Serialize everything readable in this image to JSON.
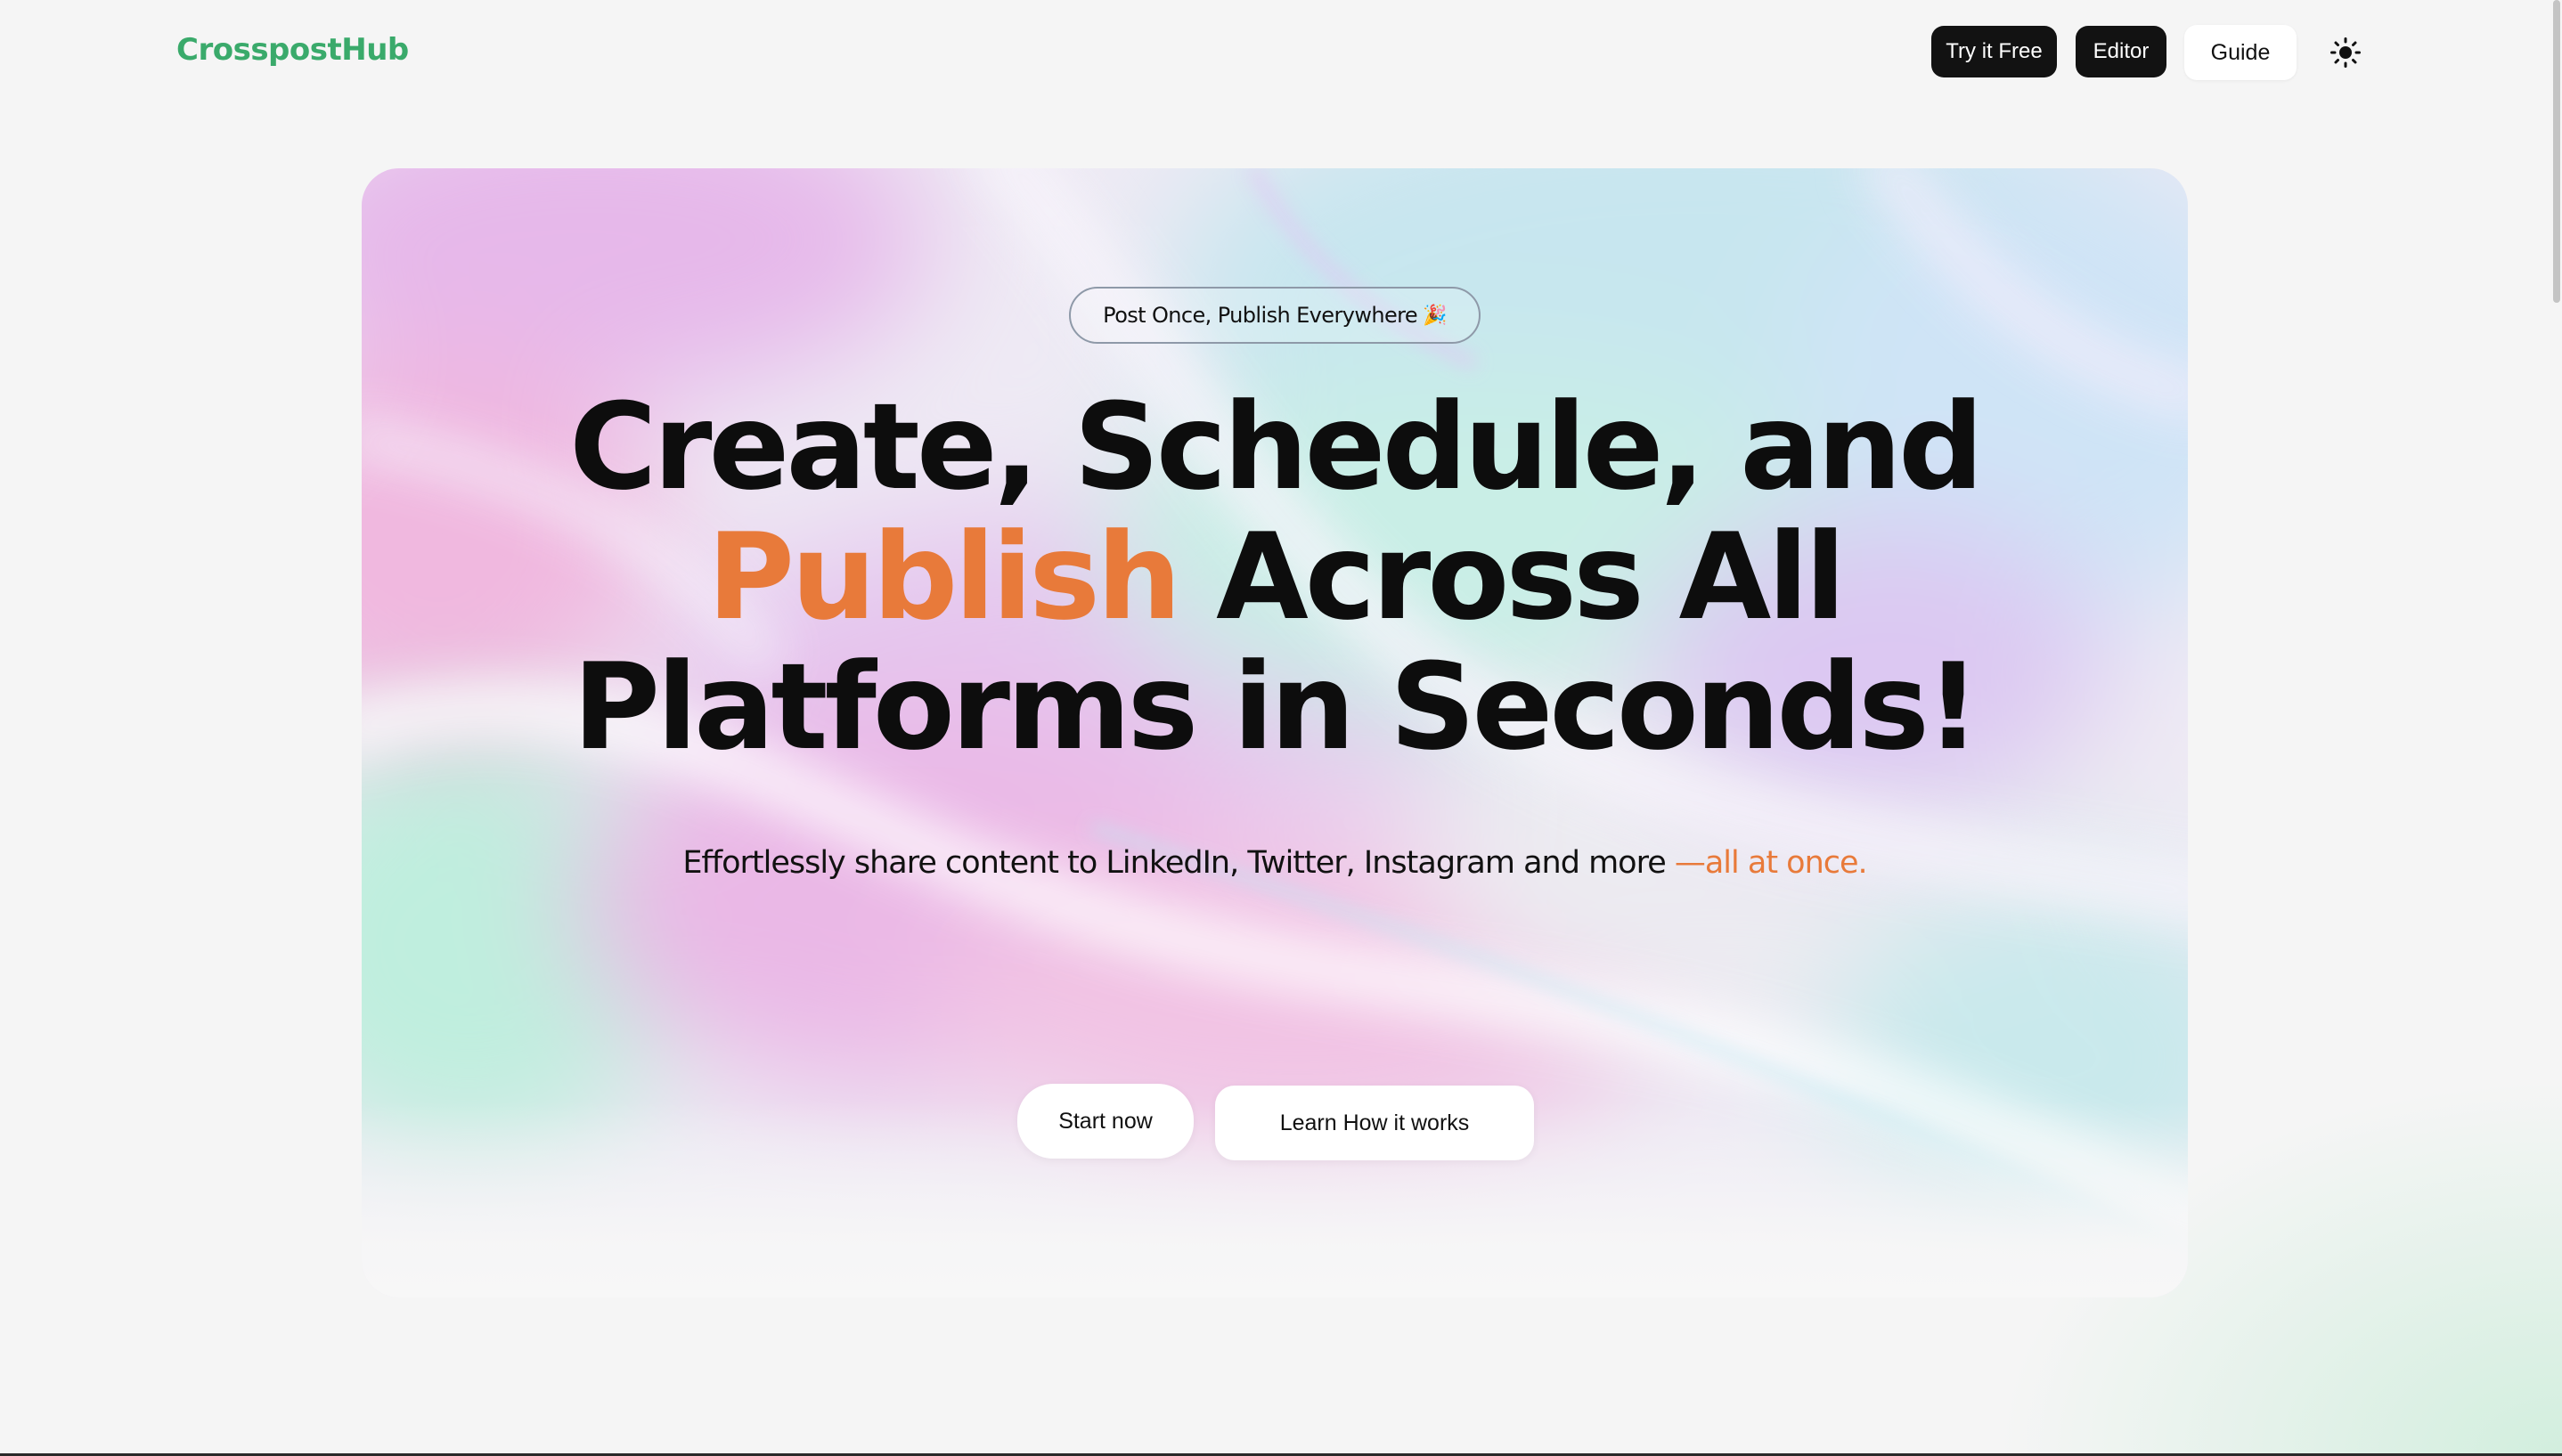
{
  "brand": {
    "name": "CrosspostHub",
    "color": "#3aaa6b"
  },
  "nav": {
    "try_free": "Try it Free",
    "editor": "Editor",
    "guide": "Guide",
    "theme_icon": "sun-icon"
  },
  "hero": {
    "badge_text": "Post Once, Publish Everywhere",
    "badge_emoji": "🎉",
    "headline_line1": "Create, Schedule, and",
    "headline_accent": "Publish",
    "headline_line2_rest": " Across All",
    "headline_line3": "Platforms in Seconds!",
    "subtitle_main": "Effortlessly share content to LinkedIn, Twitter, Instagram and more ",
    "subtitle_accent": "—all at once.",
    "accent_color": "#e87a3a"
  },
  "cta": {
    "start": "Start now",
    "learn": "Learn How it works"
  }
}
